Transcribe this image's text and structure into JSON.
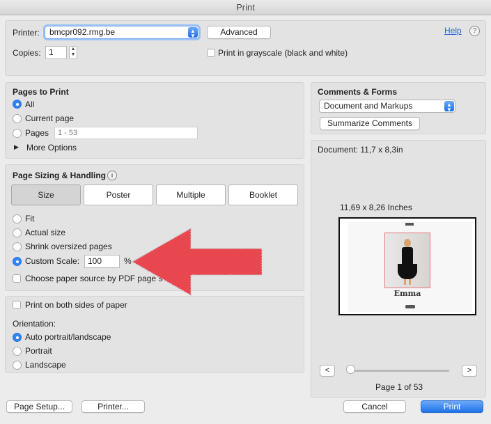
{
  "window": {
    "title": "Print"
  },
  "header": {
    "printer_label": "Printer:",
    "printer_value": "bmcpr092.rmg.be",
    "advanced_label": "Advanced",
    "help_label": "Help",
    "help_icon": "?",
    "copies_label": "Copies:",
    "copies_value": "1",
    "grayscale_label": "Print in grayscale (black and white)",
    "grayscale_checked": false
  },
  "pages_to_print": {
    "title": "Pages to Print",
    "options": [
      "All",
      "Current page",
      "Pages"
    ],
    "selected": "All",
    "pages_placeholder": "1 - 53",
    "more_options": "More Options"
  },
  "page_sizing": {
    "title": "Page Sizing & Handling",
    "info_icon": "i",
    "tabs": [
      "Size",
      "Poster",
      "Multiple",
      "Booklet"
    ],
    "active_tab": "Size",
    "options": [
      "Fit",
      "Actual size",
      "Shrink oversized pages",
      "Custom Scale:"
    ],
    "selected": "Custom Scale:",
    "scale_value": "100",
    "scale_unit": "%",
    "paper_source_label": "Choose paper source by PDF page s"
  },
  "duplex": {
    "both_sides_label": "Print on both sides of paper",
    "orientation_label": "Orientation:",
    "orientation_options": [
      "Auto portrait/landscape",
      "Portrait",
      "Landscape"
    ],
    "orientation_selected": "Auto portrait/landscape"
  },
  "comments_forms": {
    "title": "Comments & Forms",
    "value": "Document and Markups",
    "summarize_label": "Summarize Comments"
  },
  "preview": {
    "document_size": "Document: 11,7 x 8,3in",
    "paper_size": "11,69 x 8,26 Inches",
    "doc_name": "Emma",
    "prev_label": "<",
    "next_label": ">",
    "page_indicator": "Page 1 of 53",
    "slider_position": 0
  },
  "footer": {
    "page_setup_label": "Page Setup...",
    "printer_label": "Printer...",
    "cancel_label": "Cancel",
    "print_label": "Print"
  },
  "colors": {
    "accent": "#2f84f7",
    "arrow": "#e8474f"
  }
}
